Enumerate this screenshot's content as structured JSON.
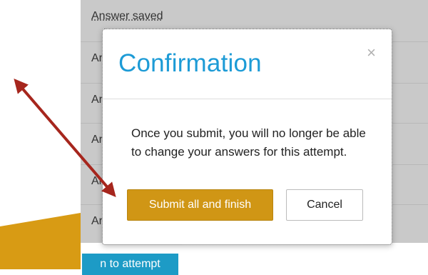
{
  "background": {
    "rows": [
      {
        "label": "Answer saved"
      },
      {
        "label": "Ar"
      },
      {
        "label": "Ar"
      },
      {
        "label": "Ar"
      },
      {
        "label": "Ar"
      },
      {
        "label": "Ar"
      }
    ],
    "nav_button_label": "n to attempt"
  },
  "modal": {
    "title": "Confirmation",
    "close_glyph": "×",
    "message": "Once you submit, you will no longer be able to change your answers for this attempt.",
    "submit_label": "Submit all and finish",
    "cancel_label": "Cancel"
  },
  "colors": {
    "accent_blue": "#1d9bd6",
    "submit_gold": "#d09615",
    "annotation_arrow": "#a6261d"
  }
}
